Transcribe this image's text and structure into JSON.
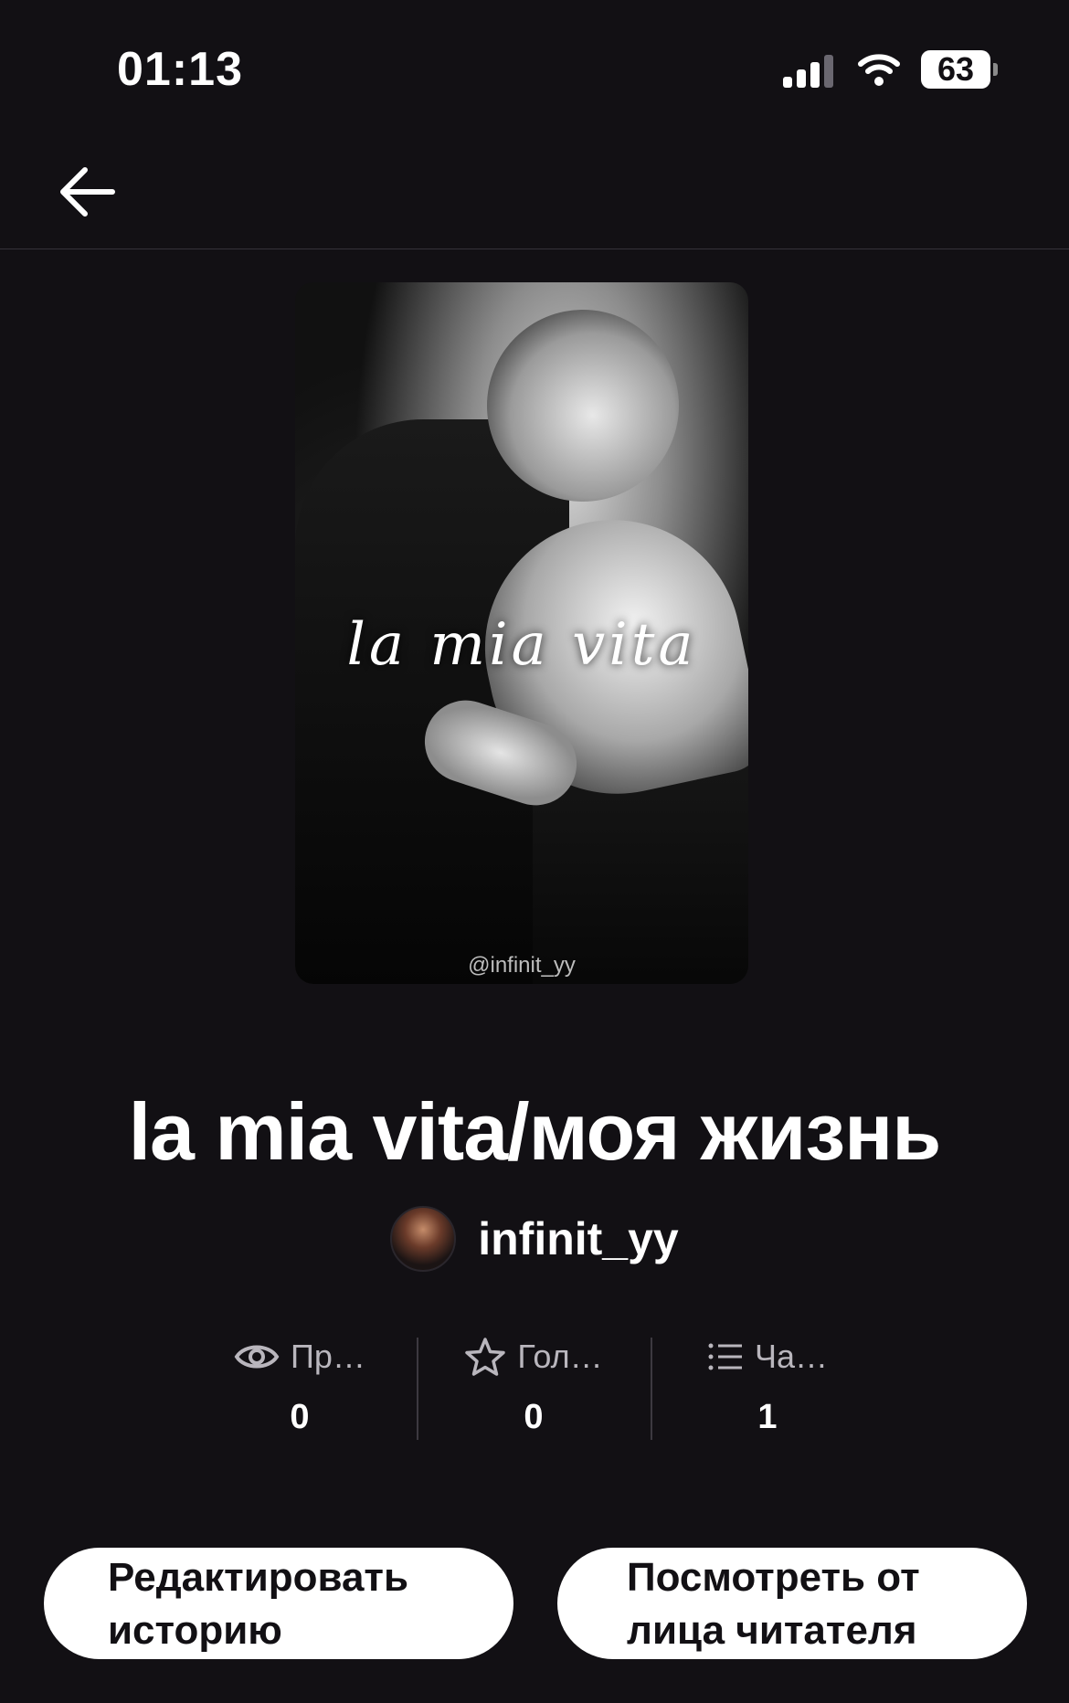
{
  "status_bar": {
    "time": "01:13",
    "battery": "63"
  },
  "cover": {
    "title_text": "la mia vita",
    "watermark": "@infinit_yy"
  },
  "story": {
    "title": "la mia vita/моя жизнь",
    "author": "infinit_yy"
  },
  "stats": [
    {
      "icon": "eye-icon",
      "label": "Пр…",
      "value": "0"
    },
    {
      "icon": "star-icon",
      "label": "Гол…",
      "value": "0"
    },
    {
      "icon": "list-icon",
      "label": "Ча…",
      "value": "1"
    }
  ],
  "buttons": {
    "edit": "Редактировать историю",
    "preview": "Посмотреть от лица читателя"
  },
  "colors": {
    "background": "#121014",
    "text": "#ffffff",
    "button_bg": "#ffffff",
    "muted": "#b9b6bd"
  }
}
